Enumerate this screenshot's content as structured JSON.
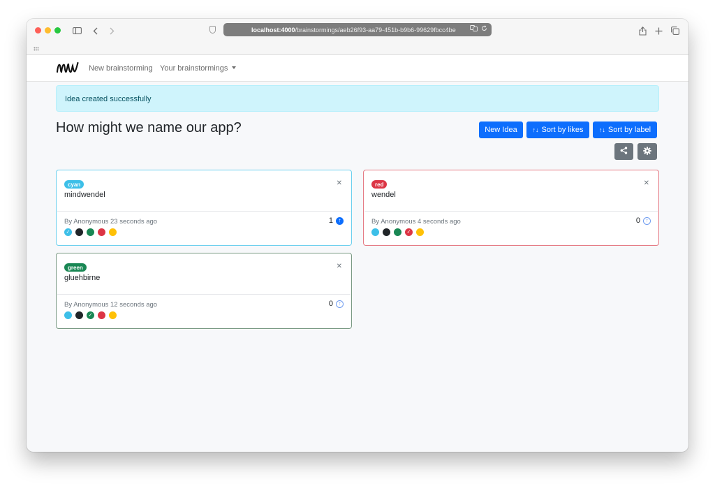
{
  "browser": {
    "url_host": "localhost:4000",
    "url_path": "/brainstormings/aeb26f93-aa79-451b-b9b6-99629fbcc4be"
  },
  "nav": {
    "logo_text": "mw",
    "new_brainstorming": "New brainstorming",
    "your_brainstormings": "Your brainstormings"
  },
  "alert": {
    "message": "Idea created successfully"
  },
  "page": {
    "title": "How might we name our app?",
    "new_idea_label": "New Idea",
    "sort_likes_label": "Sort by likes",
    "sort_label_label": "Sort by label"
  },
  "ideas": [
    {
      "label": "cyan",
      "title": "mindwendel",
      "meta": "By Anonymous 23 seconds ago",
      "likes": "1",
      "selected_color": "cyan"
    },
    {
      "label": "red",
      "title": "wendel",
      "meta": "By Anonymous 4 seconds ago",
      "likes": "0",
      "selected_color": "red"
    },
    {
      "label": "green",
      "title": "gluehbirne",
      "meta": "By Anonymous 12 seconds ago",
      "likes": "0",
      "selected_color": "green"
    }
  ],
  "colors": {
    "primary": "#0d6efd",
    "secondary": "#6c757d",
    "cyan": "#3dbfe8",
    "dark": "#212529",
    "green": "#198754",
    "red": "#dc3545",
    "yellow": "#ffc107",
    "alert_bg": "#cff4fc"
  },
  "icons": [
    "sidebar-icon",
    "back-icon",
    "forward-icon",
    "shield-icon",
    "translate-icon",
    "reload-icon",
    "share-icon",
    "new-tab-icon",
    "tabs-icon",
    "share-alt-icon",
    "gear-icon",
    "sort-icon",
    "close-icon",
    "arrow-up-circle-icon",
    "check-icon"
  ]
}
